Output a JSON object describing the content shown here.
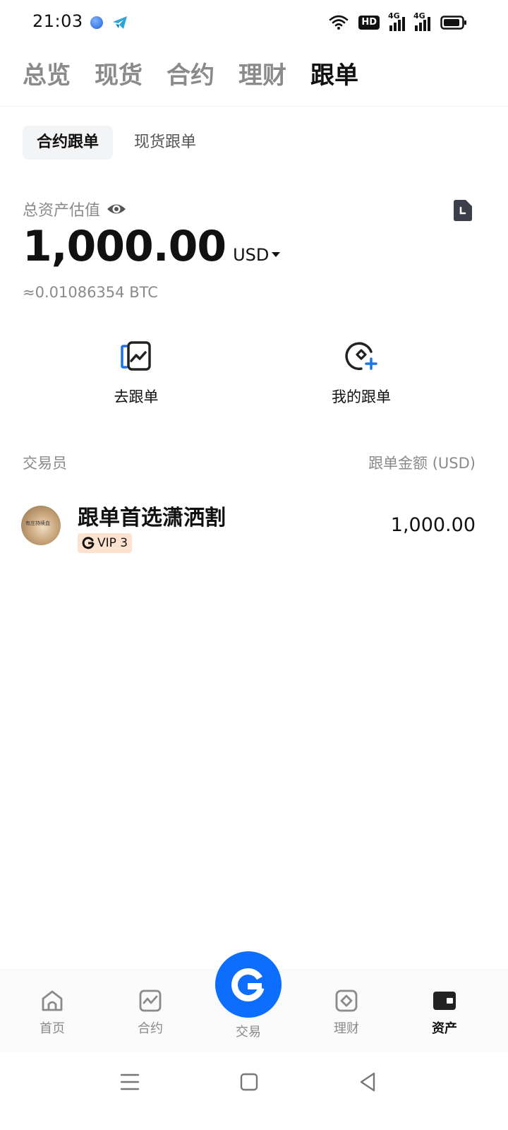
{
  "status_bar": {
    "time": "21:03",
    "hd_badge": "HD",
    "net1": "4G",
    "net2": "4G",
    "icons": [
      "app-icon-blue",
      "app-icon-telegram",
      "wifi-icon",
      "hd-icon",
      "signal-icon",
      "signal-icon",
      "battery-icon"
    ]
  },
  "top_tabs": [
    "总览",
    "现货",
    "合约",
    "理财",
    "跟单"
  ],
  "top_tab_active": "跟单",
  "sub_tabs": [
    "合约跟单",
    "现货跟单"
  ],
  "sub_tab_active": "合约跟单",
  "assets": {
    "label": "总资产估值",
    "value": "1,000.00",
    "currency": "USD",
    "btc_equiv": "≈0.01086354 BTC"
  },
  "actions": [
    {
      "label": "去跟单",
      "icon": "copy-trade-icon"
    },
    {
      "label": "我的跟单",
      "icon": "my-copy-trade-icon"
    }
  ],
  "list_header": {
    "left": "交易员",
    "right": "跟单金额 (USD)"
  },
  "traders": [
    {
      "name": "跟单首选潇洒割",
      "vip": "VIP 3",
      "amount": "1,000.00",
      "avatar_text": "有庄持续血"
    }
  ],
  "bottom_nav": [
    {
      "label": "首页",
      "icon": "home-icon"
    },
    {
      "label": "合约",
      "icon": "chart-icon"
    },
    {
      "label": "交易",
      "icon": "trade-logo-icon"
    },
    {
      "label": "理财",
      "icon": "finance-icon"
    },
    {
      "label": "资产",
      "icon": "wallet-icon"
    }
  ],
  "bottom_nav_active": "资产",
  "colors": {
    "accent": "#0d6efd",
    "vip_bg": "#fde2cf",
    "muted_text": "#8a8a8a"
  }
}
